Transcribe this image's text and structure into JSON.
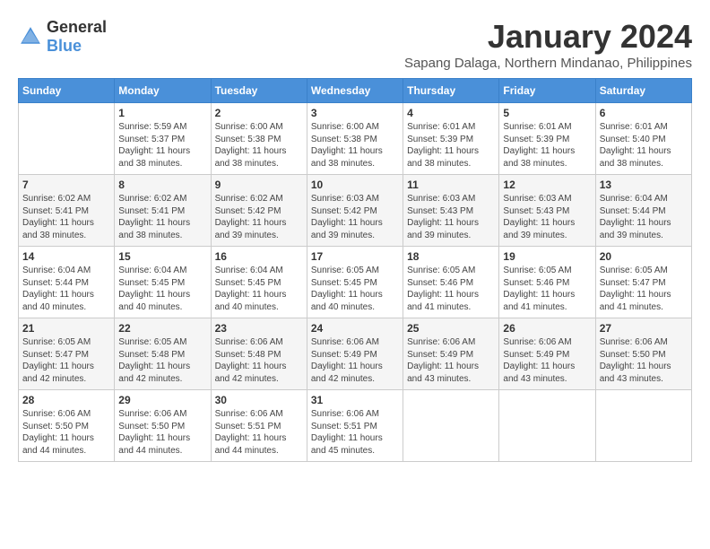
{
  "header": {
    "logo_general": "General",
    "logo_blue": "Blue",
    "month_title": "January 2024",
    "subtitle": "Sapang Dalaga, Northern Mindanao, Philippines"
  },
  "days_of_week": [
    "Sunday",
    "Monday",
    "Tuesday",
    "Wednesday",
    "Thursday",
    "Friday",
    "Saturday"
  ],
  "weeks": [
    [
      {
        "day": "",
        "sunrise": "",
        "sunset": "",
        "daylight": ""
      },
      {
        "day": "1",
        "sunrise": "Sunrise: 5:59 AM",
        "sunset": "Sunset: 5:37 PM",
        "daylight": "Daylight: 11 hours and 38 minutes."
      },
      {
        "day": "2",
        "sunrise": "Sunrise: 6:00 AM",
        "sunset": "Sunset: 5:38 PM",
        "daylight": "Daylight: 11 hours and 38 minutes."
      },
      {
        "day": "3",
        "sunrise": "Sunrise: 6:00 AM",
        "sunset": "Sunset: 5:38 PM",
        "daylight": "Daylight: 11 hours and 38 minutes."
      },
      {
        "day": "4",
        "sunrise": "Sunrise: 6:01 AM",
        "sunset": "Sunset: 5:39 PM",
        "daylight": "Daylight: 11 hours and 38 minutes."
      },
      {
        "day": "5",
        "sunrise": "Sunrise: 6:01 AM",
        "sunset": "Sunset: 5:39 PM",
        "daylight": "Daylight: 11 hours and 38 minutes."
      },
      {
        "day": "6",
        "sunrise": "Sunrise: 6:01 AM",
        "sunset": "Sunset: 5:40 PM",
        "daylight": "Daylight: 11 hours and 38 minutes."
      }
    ],
    [
      {
        "day": "7",
        "sunrise": "Sunrise: 6:02 AM",
        "sunset": "Sunset: 5:41 PM",
        "daylight": "Daylight: 11 hours and 38 minutes."
      },
      {
        "day": "8",
        "sunrise": "Sunrise: 6:02 AM",
        "sunset": "Sunset: 5:41 PM",
        "daylight": "Daylight: 11 hours and 38 minutes."
      },
      {
        "day": "9",
        "sunrise": "Sunrise: 6:02 AM",
        "sunset": "Sunset: 5:42 PM",
        "daylight": "Daylight: 11 hours and 39 minutes."
      },
      {
        "day": "10",
        "sunrise": "Sunrise: 6:03 AM",
        "sunset": "Sunset: 5:42 PM",
        "daylight": "Daylight: 11 hours and 39 minutes."
      },
      {
        "day": "11",
        "sunrise": "Sunrise: 6:03 AM",
        "sunset": "Sunset: 5:43 PM",
        "daylight": "Daylight: 11 hours and 39 minutes."
      },
      {
        "day": "12",
        "sunrise": "Sunrise: 6:03 AM",
        "sunset": "Sunset: 5:43 PM",
        "daylight": "Daylight: 11 hours and 39 minutes."
      },
      {
        "day": "13",
        "sunrise": "Sunrise: 6:04 AM",
        "sunset": "Sunset: 5:44 PM",
        "daylight": "Daylight: 11 hours and 39 minutes."
      }
    ],
    [
      {
        "day": "14",
        "sunrise": "Sunrise: 6:04 AM",
        "sunset": "Sunset: 5:44 PM",
        "daylight": "Daylight: 11 hours and 40 minutes."
      },
      {
        "day": "15",
        "sunrise": "Sunrise: 6:04 AM",
        "sunset": "Sunset: 5:45 PM",
        "daylight": "Daylight: 11 hours and 40 minutes."
      },
      {
        "day": "16",
        "sunrise": "Sunrise: 6:04 AM",
        "sunset": "Sunset: 5:45 PM",
        "daylight": "Daylight: 11 hours and 40 minutes."
      },
      {
        "day": "17",
        "sunrise": "Sunrise: 6:05 AM",
        "sunset": "Sunset: 5:45 PM",
        "daylight": "Daylight: 11 hours and 40 minutes."
      },
      {
        "day": "18",
        "sunrise": "Sunrise: 6:05 AM",
        "sunset": "Sunset: 5:46 PM",
        "daylight": "Daylight: 11 hours and 41 minutes."
      },
      {
        "day": "19",
        "sunrise": "Sunrise: 6:05 AM",
        "sunset": "Sunset: 5:46 PM",
        "daylight": "Daylight: 11 hours and 41 minutes."
      },
      {
        "day": "20",
        "sunrise": "Sunrise: 6:05 AM",
        "sunset": "Sunset: 5:47 PM",
        "daylight": "Daylight: 11 hours and 41 minutes."
      }
    ],
    [
      {
        "day": "21",
        "sunrise": "Sunrise: 6:05 AM",
        "sunset": "Sunset: 5:47 PM",
        "daylight": "Daylight: 11 hours and 42 minutes."
      },
      {
        "day": "22",
        "sunrise": "Sunrise: 6:05 AM",
        "sunset": "Sunset: 5:48 PM",
        "daylight": "Daylight: 11 hours and 42 minutes."
      },
      {
        "day": "23",
        "sunrise": "Sunrise: 6:06 AM",
        "sunset": "Sunset: 5:48 PM",
        "daylight": "Daylight: 11 hours and 42 minutes."
      },
      {
        "day": "24",
        "sunrise": "Sunrise: 6:06 AM",
        "sunset": "Sunset: 5:49 PM",
        "daylight": "Daylight: 11 hours and 42 minutes."
      },
      {
        "day": "25",
        "sunrise": "Sunrise: 6:06 AM",
        "sunset": "Sunset: 5:49 PM",
        "daylight": "Daylight: 11 hours and 43 minutes."
      },
      {
        "day": "26",
        "sunrise": "Sunrise: 6:06 AM",
        "sunset": "Sunset: 5:49 PM",
        "daylight": "Daylight: 11 hours and 43 minutes."
      },
      {
        "day": "27",
        "sunrise": "Sunrise: 6:06 AM",
        "sunset": "Sunset: 5:50 PM",
        "daylight": "Daylight: 11 hours and 43 minutes."
      }
    ],
    [
      {
        "day": "28",
        "sunrise": "Sunrise: 6:06 AM",
        "sunset": "Sunset: 5:50 PM",
        "daylight": "Daylight: 11 hours and 44 minutes."
      },
      {
        "day": "29",
        "sunrise": "Sunrise: 6:06 AM",
        "sunset": "Sunset: 5:50 PM",
        "daylight": "Daylight: 11 hours and 44 minutes."
      },
      {
        "day": "30",
        "sunrise": "Sunrise: 6:06 AM",
        "sunset": "Sunset: 5:51 PM",
        "daylight": "Daylight: 11 hours and 44 minutes."
      },
      {
        "day": "31",
        "sunrise": "Sunrise: 6:06 AM",
        "sunset": "Sunset: 5:51 PM",
        "daylight": "Daylight: 11 hours and 45 minutes."
      },
      {
        "day": "",
        "sunrise": "",
        "sunset": "",
        "daylight": ""
      },
      {
        "day": "",
        "sunrise": "",
        "sunset": "",
        "daylight": ""
      },
      {
        "day": "",
        "sunrise": "",
        "sunset": "",
        "daylight": ""
      }
    ]
  ]
}
